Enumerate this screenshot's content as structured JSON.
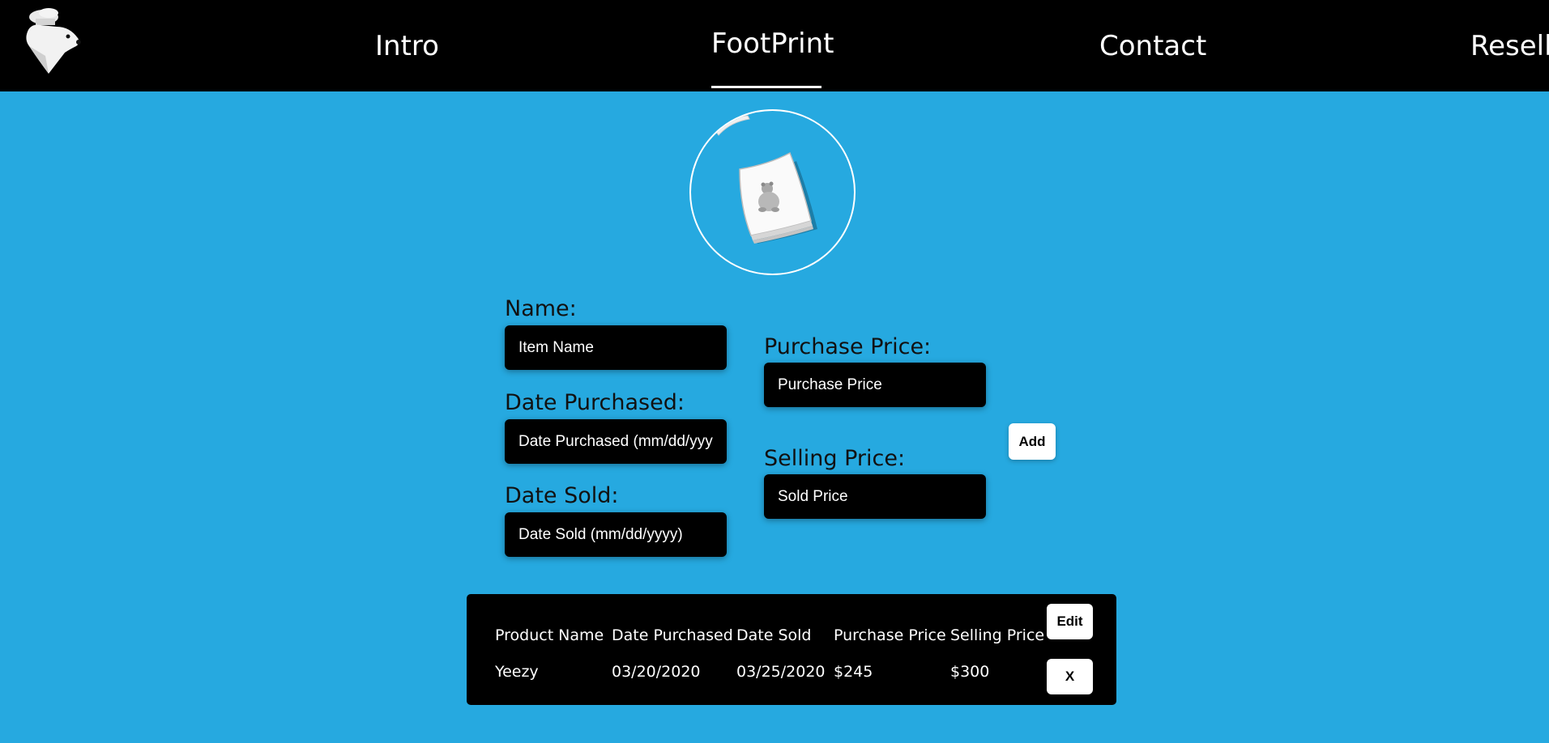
{
  "nav": {
    "links": [
      {
        "label": "Intro"
      },
      {
        "label": "FootPrint",
        "active": true
      },
      {
        "label": "Contact"
      },
      {
        "label": "Resell"
      }
    ]
  },
  "form": {
    "name": {
      "label": "Name:",
      "placeholder": "Item Name"
    },
    "date_purchased": {
      "label": "Date Purchased:",
      "placeholder": "Date Purchased (mm/dd/yyyy)"
    },
    "date_sold": {
      "label": "Date Sold:",
      "placeholder": "Date Sold (mm/dd/yyyy)"
    },
    "purchase_price": {
      "label": "Purchase Price:",
      "placeholder": "Purchase Price"
    },
    "selling_price": {
      "label": "Selling Price:",
      "placeholder": "Sold Price"
    },
    "add_label": "Add"
  },
  "table": {
    "headers": [
      "Product Name",
      "Date Purchased",
      "Date Sold",
      "Purchase Price",
      "Selling Price"
    ],
    "rows": [
      [
        "Yeezy",
        "03/20/2020",
        "03/25/2020",
        "$245",
        "$300"
      ]
    ],
    "edit_label": "Edit",
    "delete_label": "X"
  },
  "icons": {
    "logo": "polar-bear-chef-logo",
    "hero": "shoebox-polar-bear-icon"
  },
  "colors": {
    "background": "#26a9e0",
    "nav": "#000000",
    "input": "#000000",
    "text_on_dark": "#ffffff"
  }
}
